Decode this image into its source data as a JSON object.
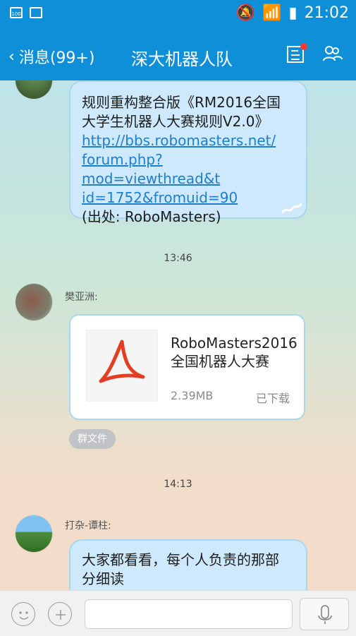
{
  "status_bar": {
    "battery_text": "100",
    "time": "21:02",
    "icons": [
      "mute-icon",
      "wifi-icon",
      "signal-icon",
      "battery-icon"
    ]
  },
  "nav": {
    "back_label": "消息(99+)",
    "title": "深大机器人队"
  },
  "messages": {
    "msg1": {
      "line1": "规则重构整合版《RM2016全国",
      "line2": "大学生机器人大赛规则V2.0》",
      "link1": "http://bbs.robomasters.net/",
      "link2": "forum.php?mod=viewthread&t",
      "link3": "id=1752&fromuid=90",
      "source": "(出处: RoboMasters)"
    },
    "time1": "13:46",
    "sender2": "樊亚洲:",
    "file": {
      "name": "RoboMasters2016全国机器人大赛",
      "size": "2.39MB",
      "status": "已下载",
      "tag": "群文件"
    },
    "time2": "14:13",
    "sender3": "打杂-谭柱:",
    "msg3": {
      "line1": "大家都看看，每个人负责的那部",
      "line2": "分细读"
    }
  },
  "input": {
    "placeholder": ""
  },
  "colors": {
    "brand": "#0f8fd8",
    "bubble": "#cde9fb",
    "link": "#1f7fcf"
  }
}
